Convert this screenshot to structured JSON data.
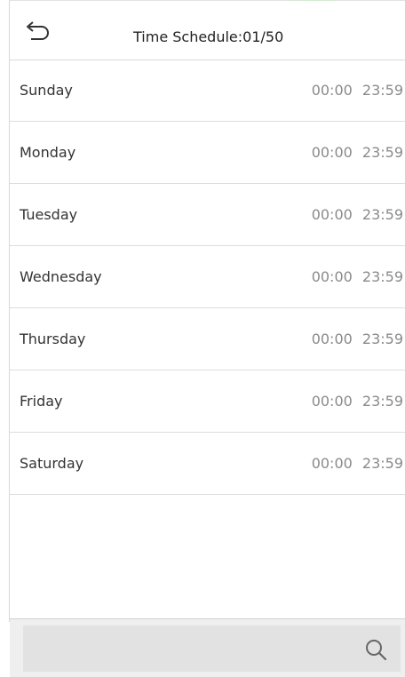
{
  "header": {
    "title": "Time Schedule:01/50",
    "back_icon": "undo-arrow-icon"
  },
  "schedule": {
    "rows": [
      {
        "day": "Sunday",
        "time": "00:00 23:59"
      },
      {
        "day": "Monday",
        "time": "00:00 23:59"
      },
      {
        "day": "Tuesday",
        "time": "00:00 23:59"
      },
      {
        "day": "Wednesday",
        "time": "00:00 23:59"
      },
      {
        "day": "Thursday",
        "time": "00:00 23:59"
      },
      {
        "day": "Friday",
        "time": "00:00 23:59"
      },
      {
        "day": "Saturday",
        "time": "00:00 23:59"
      }
    ]
  },
  "search": {
    "placeholder": "",
    "icon": "search-icon"
  },
  "colors": {
    "title_text": "#222222",
    "day_text": "#333333",
    "time_text": "#8a8a8a",
    "divider": "#dddddd",
    "search_bar": "#efefef"
  }
}
